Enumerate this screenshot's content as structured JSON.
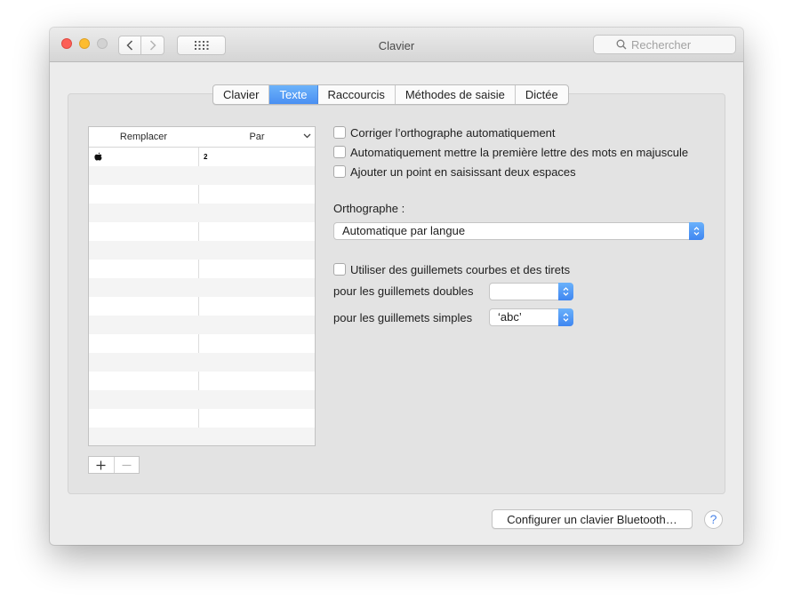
{
  "window": {
    "title": "Clavier",
    "search_placeholder": "Rechercher"
  },
  "tabs": [
    {
      "label": "Clavier",
      "active": false
    },
    {
      "label": "Texte",
      "active": true
    },
    {
      "label": "Raccourcis",
      "active": false
    },
    {
      "label": "Méthodes de saisie",
      "active": false
    },
    {
      "label": "Dictée",
      "active": false
    }
  ],
  "table": {
    "headers": {
      "replace": "Remplacer",
      "with": "Par"
    },
    "rows": [
      {
        "replace": "",
        "with": "2"
      }
    ]
  },
  "options": {
    "autocorrect_label": "Corriger l’orthographe automatiquement",
    "capitalize_label": "Automatiquement mettre la première lettre des mots en majuscule",
    "period_label": "Ajouter un point en saisissant deux espaces",
    "spelling_label": "Orthographe :",
    "spelling_value": "Automatique par langue",
    "smart_quotes_label": "Utiliser des guillemets courbes et des tirets",
    "double_quotes_label": "pour les guillemets doubles",
    "double_quotes_value": "",
    "single_quotes_label": "pour les guillemets simples",
    "single_quotes_value": "‘abc’"
  },
  "footer": {
    "bluetooth_label": "Configurer un clavier Bluetooth…",
    "help_label": "?"
  },
  "colors": {
    "accent": "#4a8ff2",
    "close": "#fc5f57",
    "minimize": "#fdbc2e"
  }
}
